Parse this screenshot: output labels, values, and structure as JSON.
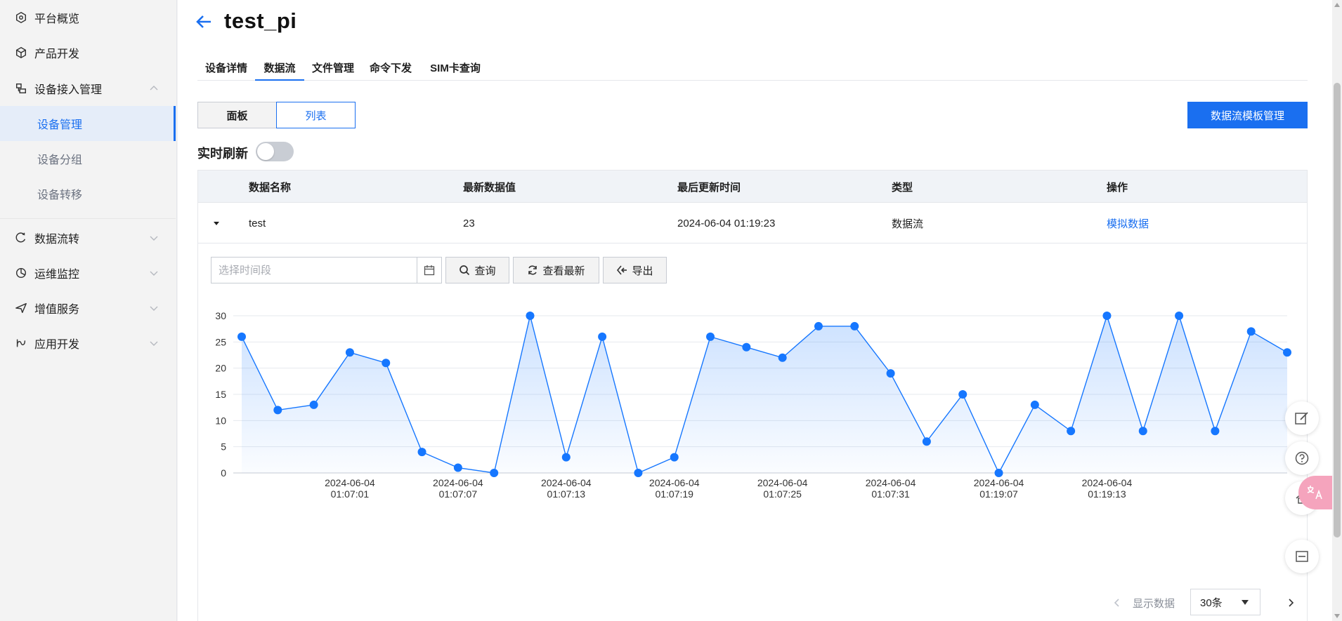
{
  "sidebar": {
    "items": [
      {
        "label": "平台概览",
        "icon": "overview-icon"
      },
      {
        "label": "产品开发",
        "icon": "cube-icon"
      },
      {
        "label": "设备接入管理",
        "icon": "device-access-icon"
      },
      {
        "label": "设备管理"
      },
      {
        "label": "设备分组"
      },
      {
        "label": "设备转移"
      },
      {
        "label": "数据流转",
        "icon": "data-flow-icon"
      },
      {
        "label": "运维监控",
        "icon": "monitor-icon"
      },
      {
        "label": "增值服务",
        "icon": "send-icon"
      },
      {
        "label": "应用开发",
        "icon": "app-dev-icon"
      }
    ]
  },
  "header": {
    "title": "test_pi"
  },
  "tabs": [
    {
      "label": "设备详情"
    },
    {
      "label": "数据流"
    },
    {
      "label": "文件管理"
    },
    {
      "label": "命令下发"
    },
    {
      "label": "SIM卡查询"
    }
  ],
  "view_toggle": {
    "panel": "面板",
    "list": "列表"
  },
  "template_button": "数据流模板管理",
  "realtime": {
    "label": "实时刷新",
    "on": false
  },
  "table": {
    "headers": [
      "数据名称",
      "最新数据值",
      "最后更新时间",
      "类型",
      "操作"
    ],
    "rows": [
      {
        "name": "test",
        "value": "23",
        "updated": "2024-06-04 01:19:23",
        "type": "数据流",
        "action": "模拟数据"
      }
    ]
  },
  "toolbar": {
    "date_placeholder": "选择时间段",
    "query": "查询",
    "latest": "查看最新",
    "export": "导出"
  },
  "chart_data": {
    "type": "area",
    "ylim": [
      0,
      30
    ],
    "yticks": [
      "0",
      "5",
      "10",
      "15",
      "20",
      "25",
      "30"
    ],
    "xticks": [
      {
        "date": "2024-06-04",
        "time": "01:07:01"
      },
      {
        "date": "2024-06-04",
        "time": "01:07:07"
      },
      {
        "date": "2024-06-04",
        "time": "01:07:13"
      },
      {
        "date": "2024-06-04",
        "time": "01:07:19"
      },
      {
        "date": "2024-06-04",
        "time": "01:07:25"
      },
      {
        "date": "2024-06-04",
        "time": "01:07:31"
      },
      {
        "date": "2024-06-04",
        "time": "01:19:07"
      },
      {
        "date": "2024-06-04",
        "time": "01:19:13"
      }
    ],
    "series": [
      {
        "values": [
          26,
          12,
          13,
          23,
          21,
          4,
          1,
          0,
          30,
          3,
          26,
          0,
          3,
          26,
          24,
          22,
          28,
          28,
          19,
          6,
          15,
          0,
          13,
          8,
          30,
          8,
          30,
          8,
          27,
          23
        ]
      }
    ],
    "color": "#1677ff"
  },
  "pagination": {
    "label": "显示数据",
    "page_size": "30条"
  }
}
